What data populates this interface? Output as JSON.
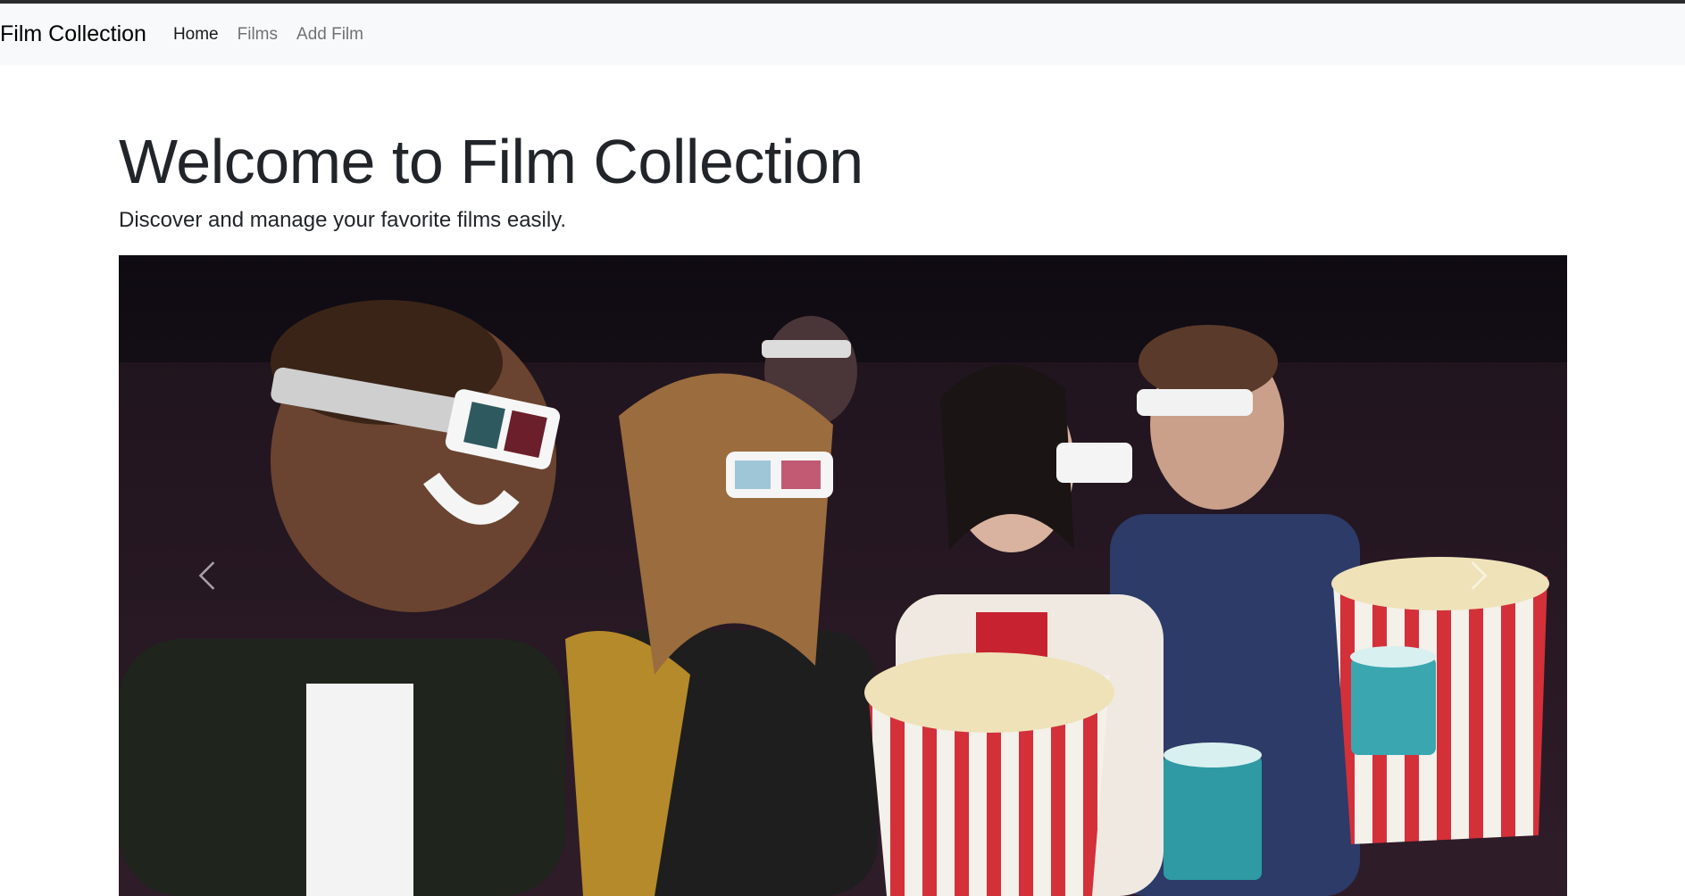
{
  "navbar": {
    "brand": "Film Collection",
    "links": [
      {
        "label": "Home"
      },
      {
        "label": "Films"
      },
      {
        "label": "Add Film"
      }
    ]
  },
  "hero": {
    "title": "Welcome to Film Collection",
    "lead": "Discover and manage your favorite films easily."
  },
  "carousel": {
    "slide_image": "audience-3d-glasses-popcorn-photo",
    "prev_icon": "chevron-left-icon",
    "next_icon": "chevron-right-icon"
  },
  "colors": {
    "navbar_bg": "#f8f9fa",
    "text": "#212529",
    "carousel_bg": "#140e16"
  }
}
